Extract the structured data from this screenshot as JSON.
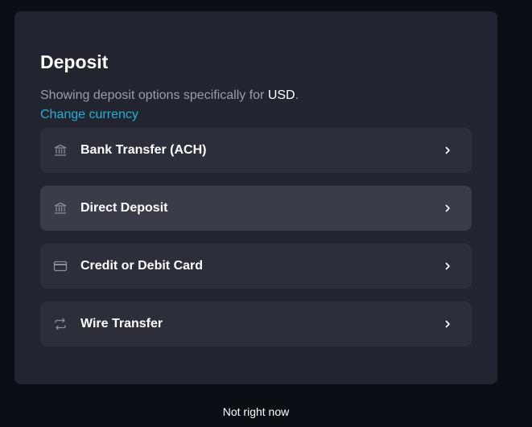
{
  "dialog": {
    "title": "Deposit",
    "subtitle_prefix": "Showing deposit options specifically for ",
    "currency": "USD",
    "subtitle_suffix": ".",
    "change_link": "Change currency"
  },
  "options": [
    {
      "label": "Bank Transfer (ACH)",
      "icon": "bank-icon"
    },
    {
      "label": "Direct Deposit",
      "icon": "bank-icon"
    },
    {
      "label": "Credit or Debit Card",
      "icon": "credit-card-icon"
    },
    {
      "label": "Wire Transfer",
      "icon": "transfer-arrows-icon"
    }
  ],
  "footer": {
    "dismiss_label": "Not right now"
  },
  "colors": {
    "background": "#0b0e15",
    "panel": "#22252f",
    "option": "#2c2f3a",
    "option_hover": "#3a3d49",
    "link": "#1fb1d6",
    "muted_text": "#9a9ea8"
  }
}
